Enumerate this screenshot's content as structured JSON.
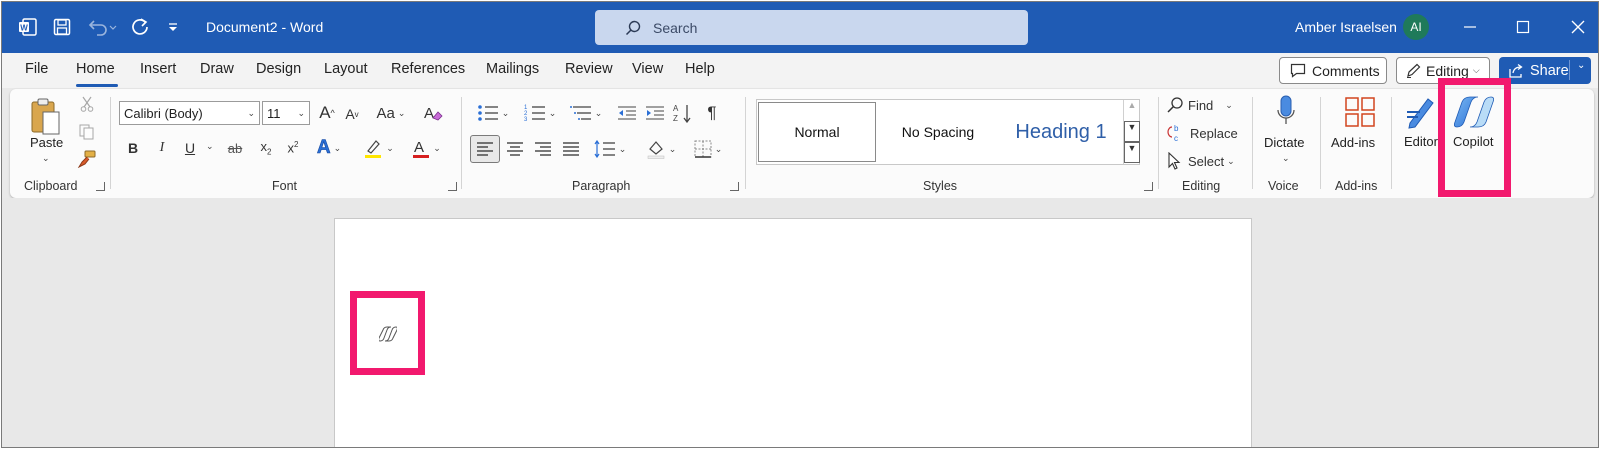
{
  "titlebar": {
    "doc_title": "Document2  -  Word",
    "search_placeholder": "Search",
    "user_name": "Amber Israelsen",
    "avatar_initials": "AI",
    "bg_color": "#1f5bb4"
  },
  "menu": {
    "items": [
      "File",
      "Home",
      "Insert",
      "Draw",
      "Design",
      "Layout",
      "References",
      "Mailings",
      "Review",
      "View",
      "Help"
    ],
    "active": "Home",
    "comments_label": "Comments",
    "editing_label": "Editing",
    "share_label": "Share"
  },
  "ribbon": {
    "clipboard": {
      "paste_label": "Paste",
      "group_label": "Clipboard"
    },
    "font": {
      "font_name": "Calibri (Body)",
      "font_size": "11",
      "change_case": "Aa",
      "bold": "B",
      "italic": "I",
      "underline": "U",
      "strike": "ab",
      "group_label": "Font"
    },
    "paragraph": {
      "group_label": "Paragraph"
    },
    "styles": {
      "items": [
        "Normal",
        "No Spacing",
        "Heading 1"
      ],
      "group_label": "Styles"
    },
    "editing": {
      "find_label": "Find",
      "replace_label": "Replace",
      "select_label": "Select",
      "group_label": "Editing"
    },
    "voice": {
      "dictate_label": "Dictate",
      "group_label": "Voice"
    },
    "addins": {
      "addins_label": "Add-ins",
      "group_label": "Add-ins"
    },
    "editor_label": "Editor",
    "copilot_label": "Copilot"
  },
  "highlight_color": "#f2196e"
}
